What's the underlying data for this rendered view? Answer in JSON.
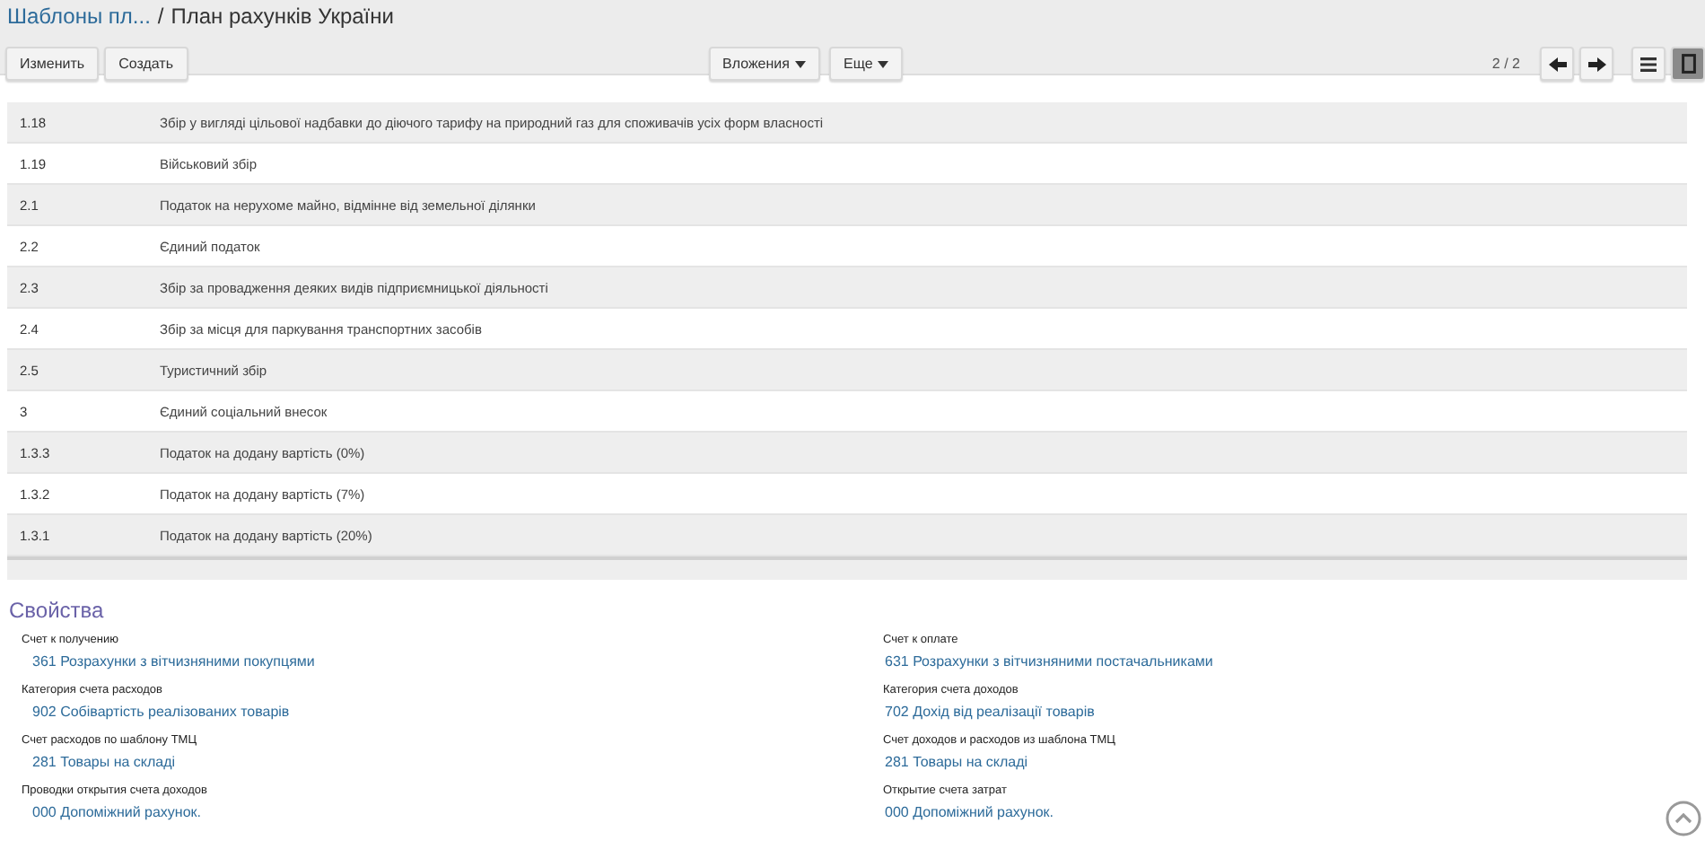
{
  "breadcrumb": {
    "parent": "Шаблоны пл...",
    "separator": "/",
    "current": "План рахунків України"
  },
  "toolbar": {
    "left_buttons": [
      "Изменить",
      "Создать"
    ],
    "dropdowns": [
      "Вложения",
      "Еще"
    ],
    "pager": "2 / 2",
    "view_modes": [
      {
        "kind": "list",
        "selected": false
      },
      {
        "kind": "form",
        "selected": true
      }
    ]
  },
  "table": {
    "rows": [
      {
        "code": "1.18",
        "name": "Збір у вигляді цільової надбавки до діючого тарифу на природний газ для споживачів усіх форм власності"
      },
      {
        "code": "1.19",
        "name": "Військовий збір"
      },
      {
        "code": "2.1",
        "name": "Податок на нерухоме майно, відмінне від земельної ділянки"
      },
      {
        "code": "2.2",
        "name": "Єдиний податок"
      },
      {
        "code": "2.3",
        "name": "Збір за провадження деяких видів підприємницької діяльності"
      },
      {
        "code": "2.4",
        "name": "Збір за місця для паркування транспортних засобів"
      },
      {
        "code": "2.5",
        "name": "Туристичний збір"
      },
      {
        "code": "3",
        "name": "Єдиний соціальний внесок"
      },
      {
        "code": "1.3.3",
        "name": "Податок на додану вартість (0%)"
      },
      {
        "code": "1.3.2",
        "name": "Податок на додану вартість (7%)"
      },
      {
        "code": "1.3.1",
        "name": "Податок на додану вартість (20%)"
      }
    ]
  },
  "properties": {
    "title": "Свойства",
    "fields": [
      {
        "label": "Счет к получению",
        "value": "361 Розрахунки з вітчизняними покупцями"
      },
      {
        "label": "Счет к оплате",
        "value": "631 Розрахунки з вітчизняними постачальниками"
      },
      {
        "label": "Категория счета расходов",
        "value": "902 Собівартість реалізованих товарів"
      },
      {
        "label": "Категория счета доходов",
        "value": "702 Дохід від реалізації товарів"
      },
      {
        "label": "Счет расходов по шаблону ТМЦ",
        "value": "281 Товары на складі"
      },
      {
        "label": "Счет доходов и расходов из шаблона ТМЦ",
        "value": "281 Товары на складі"
      },
      {
        "label": "Проводки открытия счета доходов",
        "value": "000 Допоміжний рахунок."
      },
      {
        "label": "Открытие счета затрат",
        "value": "000 Допоміжний рахунок."
      }
    ]
  }
}
